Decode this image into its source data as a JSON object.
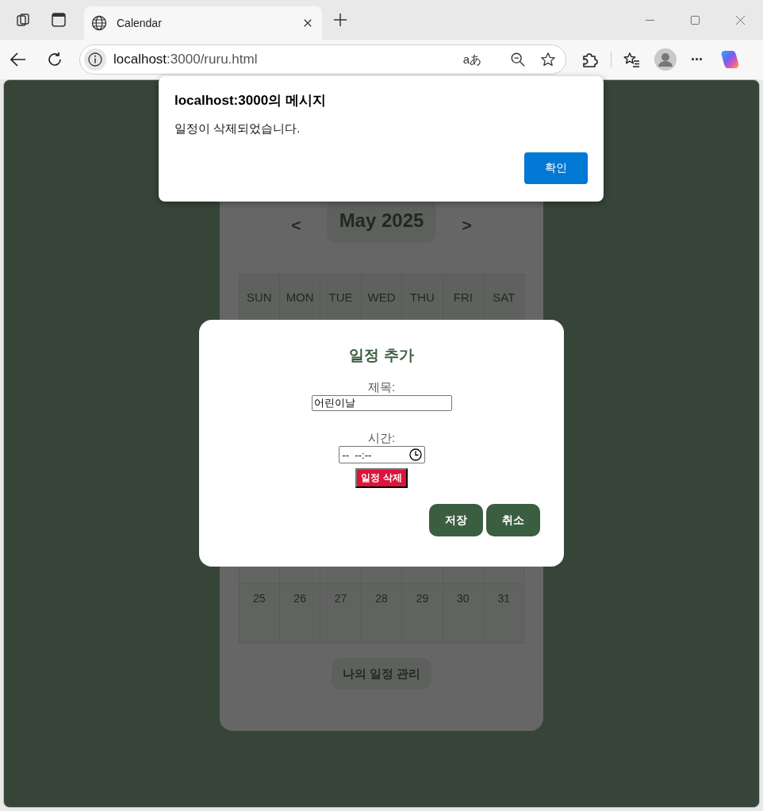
{
  "browser": {
    "tabs": [
      {
        "title": "Calendar",
        "selected": true
      }
    ],
    "address": {
      "host": "localhost",
      "path": ":3000/ruru.html"
    },
    "read_aloud_glyph": "aあ",
    "more_glyph": "···"
  },
  "calendar": {
    "prev": "<",
    "month_title": "May 2025",
    "next": ">",
    "weekdays": [
      "SUN",
      "MON",
      "TUE",
      "WED",
      "THU",
      "FRI",
      "SAT"
    ],
    "visible_week": [
      "25",
      "26",
      "27",
      "28",
      "29",
      "30",
      "31"
    ],
    "manage_button": "나의 일정 관리"
  },
  "modal": {
    "title": "일정 추가",
    "fields": [
      {
        "kind": "text",
        "label": "제목:",
        "value": "어린이날"
      },
      {
        "kind": "time",
        "label": "시간:",
        "value": "--  --:--"
      }
    ],
    "delete_button": "일정 삭제",
    "buttons": [
      "저장",
      "취소"
    ]
  },
  "alert": {
    "title": "localhost:3000의 메시지",
    "message": "일정이 삭제되었습니다.",
    "ok_button": "확인"
  }
}
